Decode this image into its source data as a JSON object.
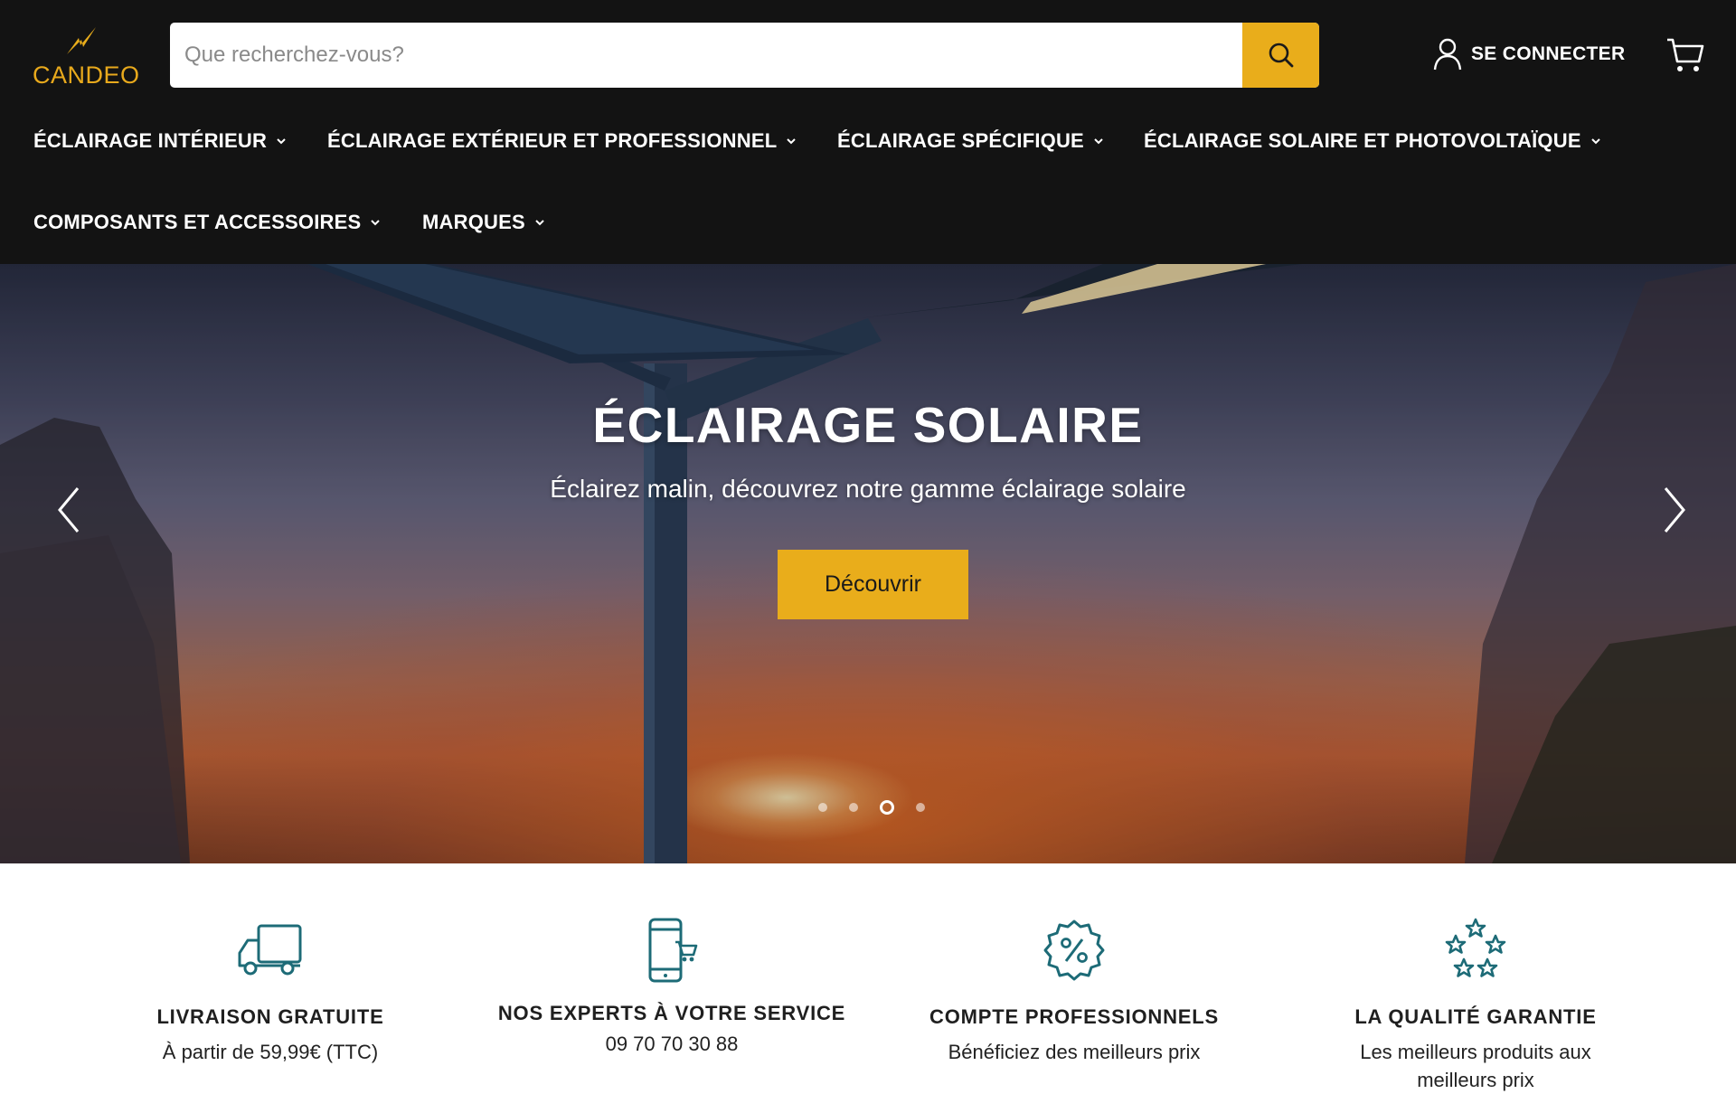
{
  "brand": {
    "name": "CANDEO",
    "accent_color": "#e9ad1b",
    "header_bg": "#131313"
  },
  "search": {
    "placeholder": "Que recherchez-vous?",
    "value": "",
    "button_icon": "search-icon"
  },
  "account": {
    "login_label": "SE CONNECTER",
    "icon": "user-icon"
  },
  "cart": {
    "icon": "cart-icon"
  },
  "nav": {
    "items": [
      {
        "label": "ÉCLAIRAGE INTÉRIEUR"
      },
      {
        "label": "ÉCLAIRAGE EXTÉRIEUR ET PROFESSIONNEL"
      },
      {
        "label": "ÉCLAIRAGE SPÉCIFIQUE"
      },
      {
        "label": "ÉCLAIRAGE SOLAIRE ET PHOTOVOLTAÏQUE"
      },
      {
        "label": "COMPOSANTS ET ACCESSOIRES"
      },
      {
        "label": "MARQUES"
      }
    ]
  },
  "hero": {
    "title": "ÉCLAIRAGE SOLAIRE",
    "subtitle": "Éclairez malin, découvrez notre gamme éclairage solaire",
    "cta_label": "Découvrir",
    "slides_count": 4,
    "active_slide": 3
  },
  "features": [
    {
      "icon": "delivery-truck-icon",
      "title": "LIVRAISON GRATUITE",
      "text": "À partir de 59,99€ (TTC)"
    },
    {
      "icon": "mobile-shop-icon",
      "title": "NOS EXPERTS À VOTRE SERVICE",
      "text": "09 70 70 30 88"
    },
    {
      "icon": "discount-badge-icon",
      "title": "COMPTE PROFESSIONNELS",
      "text": "Bénéficiez des meilleurs prix"
    },
    {
      "icon": "stars-icon",
      "title": "LA QUALITÉ GARANTIE",
      "text": "Les meilleurs produits aux meilleurs prix"
    }
  ]
}
